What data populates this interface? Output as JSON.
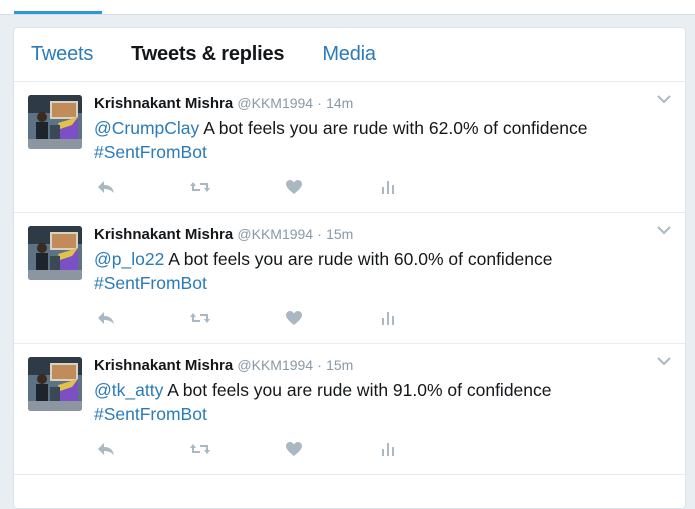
{
  "tabs": [
    {
      "label": "Tweets",
      "active": false
    },
    {
      "label": "Tweets & replies",
      "active": true
    },
    {
      "label": "Media",
      "active": false
    }
  ],
  "tweets": [
    {
      "fullname": "Krishnakant Mishra",
      "username": "@KKM1994",
      "separator": "·",
      "time": "14m",
      "mention": "@CrumpClay",
      "text": " A bot feels you are rude with 62.0% of confidence",
      "hashtag": "#SentFromBot"
    },
    {
      "fullname": "Krishnakant Mishra",
      "username": "@KKM1994",
      "separator": "·",
      "time": "15m",
      "mention": "@p_lo22",
      "text": " A bot feels you are rude with 60.0% of confidence",
      "hashtag": "#SentFromBot"
    },
    {
      "fullname": "Krishnakant Mishra",
      "username": "@KKM1994",
      "separator": "·",
      "time": "15m",
      "mention": "@tk_atty",
      "text": " A bot feels you are rude with 91.0% of confidence",
      "hashtag": "#SentFromBot"
    }
  ],
  "icons": {
    "reply": "reply-icon",
    "retweet": "retweet-icon",
    "like": "heart-icon",
    "analytics": "analytics-icon",
    "caret": "chevron-down-icon"
  },
  "colors": {
    "link": "#2b7bb9",
    "muted": "#8899a6",
    "action_icon": "#aab8c2",
    "text": "#14171a",
    "active_underline": "#2b9ad3"
  }
}
